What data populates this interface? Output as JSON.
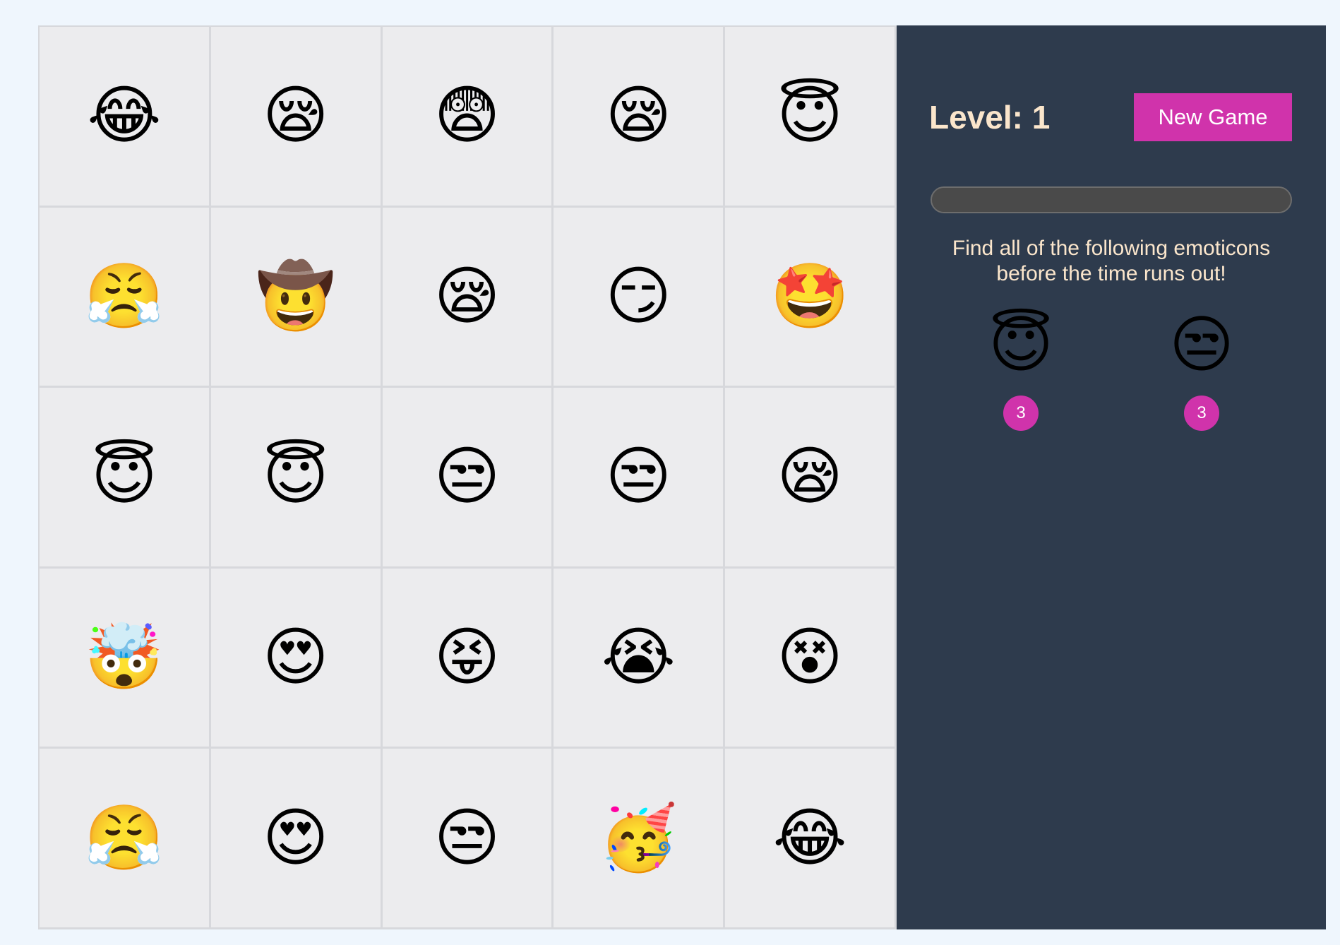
{
  "board": {
    "cells": [
      {
        "emoji": "😂",
        "icon": "face-with-tears-of-joy-icon"
      },
      {
        "emoji": "😪",
        "icon": "sleepy-face-icon"
      },
      {
        "emoji": "😨",
        "icon": "fearful-face-icon"
      },
      {
        "emoji": "😪",
        "icon": "sleepy-face-icon"
      },
      {
        "emoji": "😇",
        "icon": "smiling-face-with-halo-icon"
      },
      {
        "emoji": "😤",
        "icon": "face-with-steam-from-nose-icon"
      },
      {
        "emoji": "🤠",
        "icon": "cowboy-hat-face-icon"
      },
      {
        "emoji": "😪",
        "icon": "sleepy-face-icon"
      },
      {
        "emoji": "😏",
        "icon": "smirking-face-icon"
      },
      {
        "emoji": "🤩",
        "icon": "star-struck-icon"
      },
      {
        "emoji": "😇",
        "icon": "smiling-face-with-halo-icon"
      },
      {
        "emoji": "😇",
        "icon": "smiling-face-with-halo-icon"
      },
      {
        "emoji": "😒",
        "icon": "unamused-face-icon"
      },
      {
        "emoji": "😒",
        "icon": "unamused-face-icon"
      },
      {
        "emoji": "😪",
        "icon": "sleepy-face-icon"
      },
      {
        "emoji": "🤯",
        "icon": "exploding-head-icon"
      },
      {
        "emoji": "😍",
        "icon": "heart-eyes-face-icon"
      },
      {
        "emoji": "😝",
        "icon": "squinting-face-with-tongue-icon"
      },
      {
        "emoji": "😭",
        "icon": "loudly-crying-face-icon"
      },
      {
        "emoji": "😵",
        "icon": "dizzy-face-icon"
      },
      {
        "emoji": "😤",
        "icon": "face-with-steam-from-nose-icon"
      },
      {
        "emoji": "😍",
        "icon": "heart-eyes-face-icon"
      },
      {
        "emoji": "😒",
        "icon": "unamused-face-icon"
      },
      {
        "emoji": "🥳",
        "icon": "partying-face-icon"
      },
      {
        "emoji": "😂",
        "icon": "face-with-tears-of-joy-icon"
      }
    ]
  },
  "panel": {
    "level_text": "Level: 1",
    "new_game_label": "New Game",
    "timer_fraction_remaining": 1.0,
    "instructions_line1": "Find all of the following emoticons",
    "instructions_line2": "before the time runs out!",
    "targets": [
      {
        "emoji": "😇",
        "icon": "smiling-face-with-halo-icon",
        "count": "3"
      },
      {
        "emoji": "😒",
        "icon": "unamused-face-icon",
        "count": "3"
      }
    ]
  },
  "colors": {
    "panel_bg": "#2e3b4d",
    "accent": "#d033ab",
    "text_cream": "#fbe6cc",
    "board_bg": "#ececee"
  }
}
